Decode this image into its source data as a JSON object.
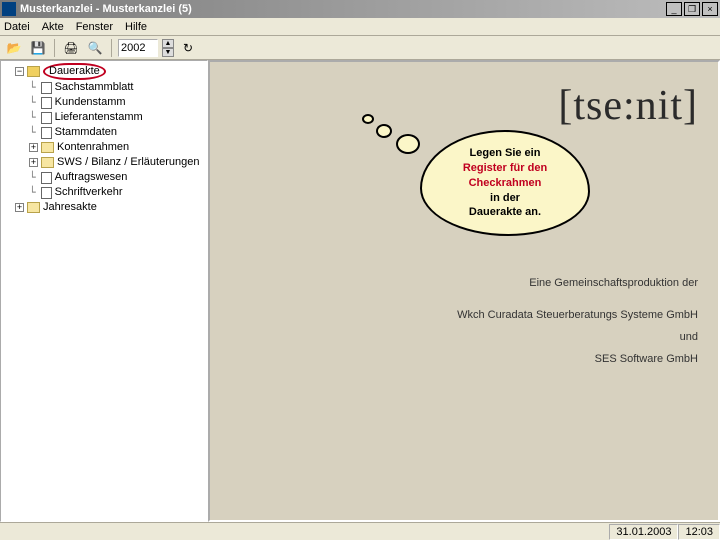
{
  "window": {
    "title": "Musterkanzlei - Musterkanzlei (5)",
    "min": "_",
    "restore": "❐",
    "close": "×"
  },
  "menu": {
    "datei": "Datei",
    "akte": "Akte",
    "fenster": "Fenster",
    "hilfe": "Hilfe"
  },
  "toolbar": {
    "open": "📂",
    "save": "💾",
    "print": "🖨",
    "preview": "🔍",
    "year": "2002",
    "up": "▲",
    "down": "▼",
    "refresh": "↻"
  },
  "tree": {
    "root": "Dauerakte",
    "items": [
      "Sachstammblatt",
      "Kundenstamm",
      "Lieferantenstamm",
      "Stammdaten",
      "Kontenrahmen",
      "SWS / Bilanz / Erläuterungen",
      "Auftragswesen",
      "Schriftverkehr"
    ],
    "second_root": "Jahresakte"
  },
  "callout": {
    "line1": "Legen Sie ein",
    "line2": "Register für den",
    "line3": "Checkrahmen",
    "line4": "in der",
    "line5": "Dauerakte an."
  },
  "content": {
    "logo": "[tse:nit]",
    "credit_lead": "Eine Gemeinschaftsproduktion der",
    "credit1": "Wkch Curadata Steuerberatungs Systeme GmbH",
    "credit_und": "und",
    "credit2": "SES Software GmbH"
  },
  "status": {
    "date": "31.01.2003",
    "time": "12:03"
  }
}
